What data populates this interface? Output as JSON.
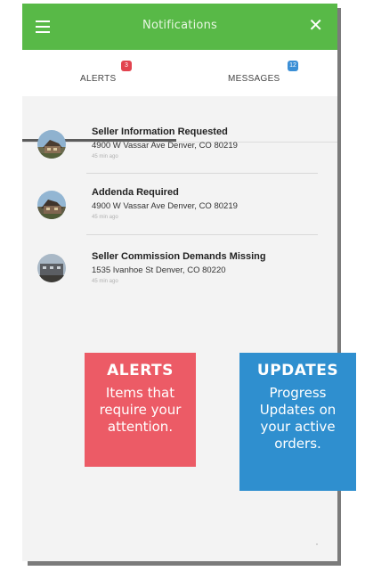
{
  "header": {
    "title": "Notifications",
    "menu_icon": "hamburger-menu-icon",
    "close_icon": "close-icon",
    "close_glyph": "✕",
    "color": "#58b947"
  },
  "tabs": [
    {
      "label": "ALERTS",
      "badge": "3",
      "badge_color": "#e2434f",
      "active": true
    },
    {
      "label": "MESSAGES",
      "badge": "12",
      "badge_color": "#3b8fd6",
      "active": false
    }
  ],
  "notifications": [
    {
      "title": "Seller Information Requested",
      "address": "4900 W Vassar Ave Denver, CO 80219",
      "time": "45 min ago"
    },
    {
      "title": "Addenda Required",
      "address": "4900 W Vassar Ave Denver, CO 80219",
      "time": "45 min ago"
    },
    {
      "title": "Seller Commission Demands Missing",
      "address": "1535 Ivanhoe St Denver, CO 80220",
      "time": "45 min ago"
    }
  ],
  "callouts": {
    "alerts": {
      "title": "ALERTS",
      "text": "Items that require your attention.",
      "color": "#ec5b66"
    },
    "updates": {
      "title": "UPDATES",
      "text": "Progress Updates on your active orders.",
      "color": "#2f8fcf"
    }
  }
}
